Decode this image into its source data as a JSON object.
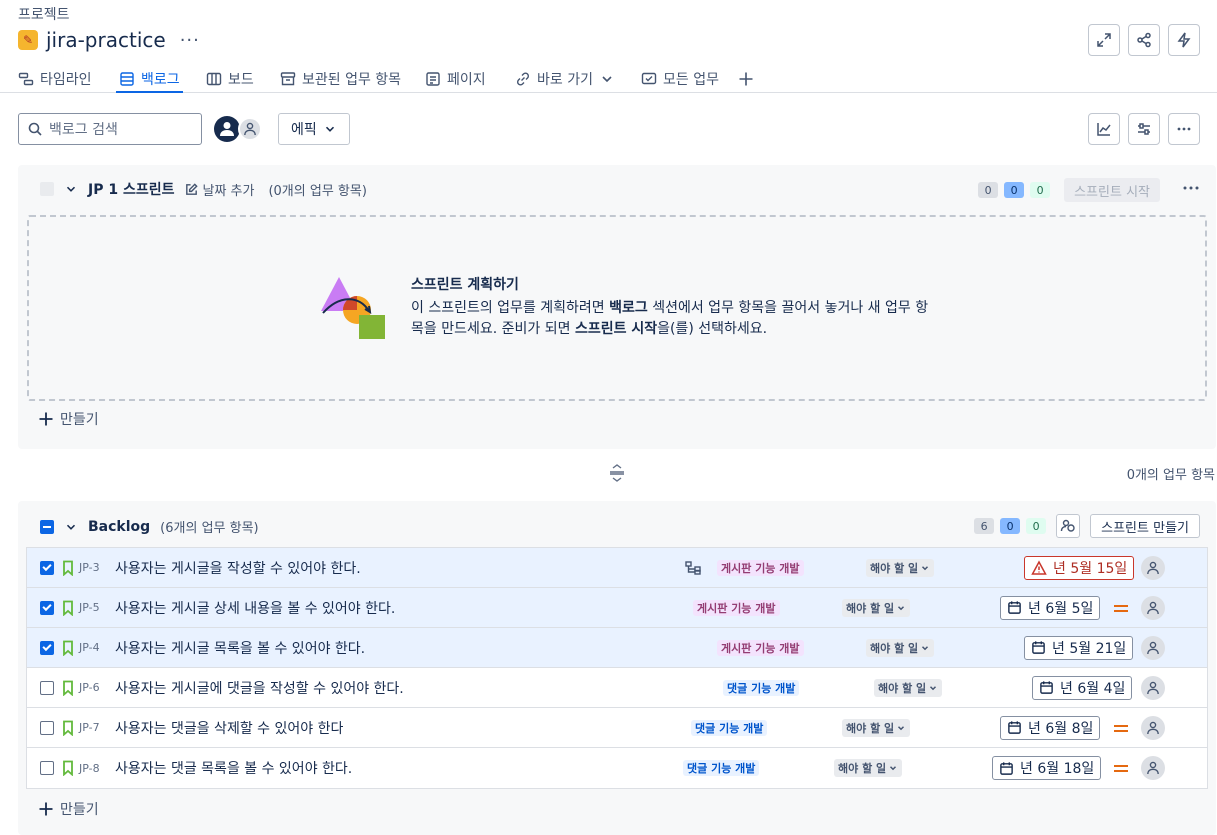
{
  "breadcrumb": "프로젝트",
  "project": {
    "name": "jira-practice",
    "more": "···"
  },
  "tabs": [
    {
      "label": "타임라인",
      "icon": "timeline-icon"
    },
    {
      "label": "백로그",
      "icon": "backlog-icon",
      "active": true
    },
    {
      "label": "보드",
      "icon": "board-icon"
    },
    {
      "label": "보관된 업무 항목",
      "icon": "archive-icon"
    },
    {
      "label": "페이지",
      "icon": "page-icon"
    },
    {
      "label": "바로 가기",
      "icon": "link-icon"
    },
    {
      "label": "모든 업무",
      "icon": "all-work-icon"
    }
  ],
  "toolbar": {
    "search_placeholder": "백로그 검색",
    "epic_label": "에픽"
  },
  "sprint": {
    "title": "JP 1 스프린트",
    "date_add": "날짜 추가",
    "count": "(0개의 업무 항목)",
    "pills": [
      "0",
      "0",
      "0"
    ],
    "start_label": "스프린트 시작",
    "plan_title": "스프린트 계획하기",
    "plan_line1_a": "이 스프린트의 업무를 계획하려면 ",
    "plan_line1_b": "백로그",
    "plan_line1_c": " 섹션에서 업무 항목을 끌어서 놓거나 새 업무 항",
    "plan_line2_a": "목을 만드세요. 준비가 되면 ",
    "plan_line2_b": "스프린트 시작",
    "plan_line2_c": "을(를) 선택하세요.",
    "create_label": "만들기"
  },
  "between": {
    "count": "0개의 업무 항목"
  },
  "backlog": {
    "title": "Backlog",
    "count": "(6개의 업무 항목)",
    "pills": [
      "6",
      "0",
      "0"
    ],
    "create_sprint_label": "스프린트 만들기",
    "create_label": "만들기",
    "rows": [
      {
        "key": "JP-3",
        "summary": "사용자는 게시글을 작성할 수 있어야 한다.",
        "epic": "게시판 기능 개발",
        "status": "해야 할 일",
        "date": "년 5월 15일",
        "selected": true,
        "overdue": true
      },
      {
        "key": "JP-5",
        "summary": "사용자는 게시글 상세 내용을 볼 수 있어야 한다.",
        "epic": "게시판 기능 개발",
        "status": "해야 할 일",
        "date": "년 6월 5일",
        "selected": true
      },
      {
        "key": "JP-4",
        "summary": "사용자는 게시글 목록을 볼 수 있어야 한다.",
        "epic": "게시판 기능 개발",
        "status": "해야 할 일",
        "date": "년 5월 21일",
        "selected": true
      },
      {
        "key": "JP-6",
        "summary": "사용자는 게시글에 댓글을 작성할 수 있어야 한다.",
        "epic": "댓글 기능 개발",
        "status": "해야 할 일",
        "date": "년 6월 4일"
      },
      {
        "key": "JP-7",
        "summary": "사용자는 댓글을 삭제할 수 있어야 한다",
        "epic": "댓글 기능 개발",
        "status": "해야 할 일",
        "date": "년 6월 8일"
      },
      {
        "key": "JP-8",
        "summary": "사용자는 댓글 목록을 볼 수 있어야 한다.",
        "epic": "댓글 기능 개발",
        "status": "해야 할 일",
        "date": "년 6월 18일"
      }
    ]
  },
  "colors": {
    "accent": "#0c66e4",
    "overdue": "#c9372c",
    "priority_medium": "#e56910",
    "epic_purple": "#943d73",
    "epic_blue": "#0055cc"
  }
}
